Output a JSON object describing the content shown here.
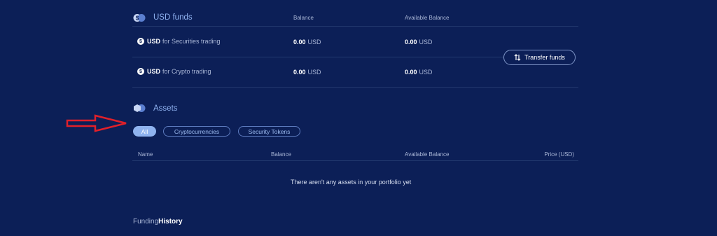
{
  "usd_funds": {
    "title": "USD funds",
    "col_balance": "Balance",
    "col_available": "Available Balance",
    "rows": [
      {
        "currency": "USD",
        "suffix": "for Securities trading",
        "balance_value": "0.00",
        "balance_unit": "USD",
        "available_value": "0.00",
        "available_unit": "USD"
      },
      {
        "currency": "USD",
        "suffix": "for Crypto trading",
        "balance_value": "0.00",
        "balance_unit": "USD",
        "available_value": "0.00",
        "available_unit": "USD"
      }
    ],
    "transfer_label": "Transfer funds"
  },
  "assets": {
    "title": "Assets",
    "filters": [
      "All",
      "Cryptocurrencies",
      "Security Tokens"
    ],
    "active_filter": "All",
    "columns": [
      "Name",
      "Balance",
      "Available Balance",
      "Price (USD)"
    ],
    "empty_message": "There aren't any assets in your portfolio yet"
  },
  "funding_history": {
    "part1": "Funding",
    "part2": "History"
  },
  "colors": {
    "background": "#0c1f57",
    "accent": "#8fb3ef",
    "arrow": "#e0202a"
  }
}
